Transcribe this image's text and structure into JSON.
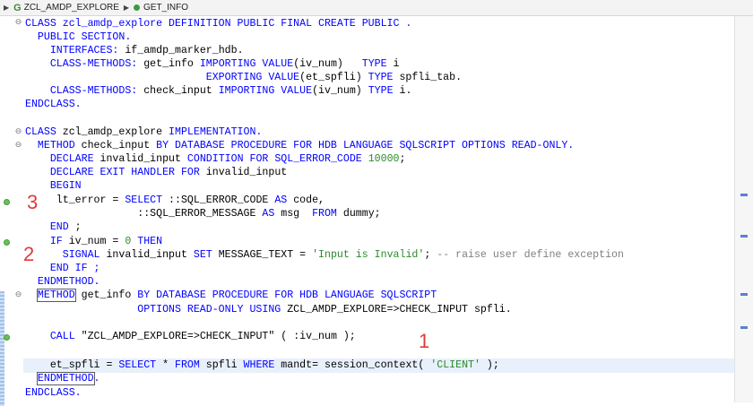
{
  "breadcrumb": {
    "class_name": "ZCL_AMDP_EXPLORE",
    "method_name": "GET_INFO",
    "icons": [
      "class-g-icon",
      "method-icon"
    ]
  },
  "code": {
    "l1": "CLASS zcl_amdp_explore DEFINITION PUBLIC FINAL CREATE PUBLIC .",
    "l2_kw": "PUBLIC SECTION.",
    "l3_kw": "INTERFACES:",
    "l3_rest": " if_amdp_marker_hdb.",
    "l4_kw1": "CLASS-METHODS:",
    "l4_a": " get_info ",
    "l4_kw2": "IMPORTING VALUE",
    "l4_b": "(iv_num)   ",
    "l4_kw3": "TYPE",
    "l4_c": " i",
    "l5_kw1": "EXPORTING VALUE",
    "l5_a": "(et_spfli) ",
    "l5_kw2": "TYPE",
    "l5_b": " spfli_tab.",
    "l6_kw1": "CLASS-METHODS:",
    "l6_a": " check_input ",
    "l6_kw2": "IMPORTING VALUE",
    "l6_b": "(iv_num) ",
    "l6_kw3": "TYPE",
    "l6_c": " i.",
    "l7": "ENDCLASS.",
    "l9_kw1": "CLASS",
    "l9_a": " zcl_amdp_explore ",
    "l9_kw2": "IMPLEMENTATION.",
    "l10_kw1": "METHOD",
    "l10_a": " check_input ",
    "l10_kw2": "BY DATABASE PROCEDURE FOR HDB LANGUAGE SQLSCRIPT OPTIONS READ-ONLY.",
    "l11_kw1": "DECLARE",
    "l11_a": " invalid_input ",
    "l11_kw2": "CONDITION FOR SQL_ERROR_CODE",
    "l11_num": " 10000",
    "l11_b": ";",
    "l12_kw1": "DECLARE EXIT HANDLER FOR",
    "l12_a": " invalid_input",
    "l13": "BEGIN",
    "l14_a": " lt_error = ",
    "l14_kw1": "SELECT",
    "l14_b": " ::SQL_ERROR_CODE ",
    "l14_kw2": "AS",
    "l14_c": " code,",
    "l15_a": "::SQL_ERROR_MESSAGE ",
    "l15_kw1": "AS",
    "l15_b": " msg  ",
    "l15_kw2": "FROM",
    "l15_c": " dummy;",
    "l16_kw": "END",
    "l16_a": " ;",
    "l17_kw1": "IF",
    "l17_a": " iv_num = ",
    "l17_num": "0",
    "l17_kw2": " THEN",
    "l18_kw1": "SIGNAL",
    "l18_a": " invalid_input ",
    "l18_kw2": "SET",
    "l18_b": " MESSAGE_TEXT = ",
    "l18_str": "'Input is Invalid'",
    "l18_c": "; ",
    "l18_cmt": "-- raise user define exception",
    "l19": "END IF ;",
    "l20": "ENDMETHOD.",
    "l21_kw1": "METHOD",
    "l21_a": " get_info ",
    "l21_kw2": "BY DATABASE PROCEDURE FOR HDB LANGUAGE SQLSCRIPT",
    "l22_kw": "OPTIONS READ-ONLY USING",
    "l22_a": " ZCL_AMDP_EXPLORE=>CHECK_INPUT spfli.",
    "l24_kw": "CALL",
    "l24_a": " \"ZCL_AMDP_EXPLORE=>CHECK_INPUT\" ( :iv_num );",
    "l26_a": "et_spfli = ",
    "l26_kw1": "SELECT",
    "l26_b": " * ",
    "l26_kw2": "FROM",
    "l26_c": " spfli ",
    "l26_kw3": "WHERE",
    "l26_d": " mandt= session_context( ",
    "l26_str": "'CLIENT'",
    "l26_e": " );",
    "l27": "ENDMETHOD",
    "l27_b": ".",
    "l28": "ENDCLASS."
  },
  "annotations": [
    "1",
    "2",
    "3"
  ],
  "colors": {
    "keyword": "#0000ff",
    "string": "#2a8a2a",
    "comment": "#7f7f7f",
    "annotation": "#e03b3b"
  }
}
